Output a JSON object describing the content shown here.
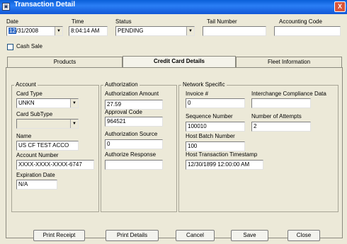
{
  "window": {
    "title": "Transaction Detail",
    "close_glyph": "X"
  },
  "header": {
    "date_label": "Date",
    "date_value_highlight": "12",
    "date_value_rest": "/31/2008",
    "time_label": "Time",
    "time_value": "8:04:14 AM",
    "status_label": "Status",
    "status_value": "PENDING",
    "tail_number_label": "Tail Number",
    "tail_number_value": "",
    "accounting_code_label": "Accounting Code",
    "accounting_code_value": "",
    "cash_sale_label": "Cash Sale",
    "cash_sale_checked": false
  },
  "tabs": [
    {
      "label": "Products",
      "active": false
    },
    {
      "label": "Credit Card Details",
      "active": true
    },
    {
      "label": "Fleet Information",
      "active": false
    }
  ],
  "account": {
    "title": "Account",
    "card_type_label": "Card Type",
    "card_type_value": "UNKN",
    "card_subtype_label": "Card SubType",
    "card_subtype_value": "",
    "name_label": "Name",
    "name_value": "US CF TEST ACCO",
    "account_number_label": "Account Number",
    "account_number_value": "XXXX-XXXX-XXXX-6747",
    "expiration_label": "Expiration Date",
    "expiration_value": "N/A"
  },
  "authorization": {
    "title": "Authorization",
    "amount_label": "Authorization Amount",
    "amount_value": "27.59",
    "approval_label": "Approval Code",
    "approval_value": "964521",
    "source_label": "Authorization Source",
    "source_value": "0",
    "response_label": "Authorize Response",
    "response_value": ""
  },
  "network": {
    "title": "Network Specific",
    "invoice_label": "Invoice #",
    "invoice_value": "0",
    "interchange_label": "Interchange Compliance Data",
    "interchange_value": "",
    "sequence_label": "Sequence Number",
    "sequence_value": "100010",
    "attempts_label": "Number of Attempts",
    "attempts_value": "2",
    "host_batch_label": "Host Batch Number",
    "host_batch_value": "100",
    "host_ts_label": "Host Transaction Timestamp",
    "host_ts_value": "12/30/1899 12:00:00 AM"
  },
  "buttons": {
    "print_receipt": "Print Receipt",
    "print_details": "Print Details",
    "cancel": "Cancel",
    "save": "Save",
    "close": "Close"
  }
}
